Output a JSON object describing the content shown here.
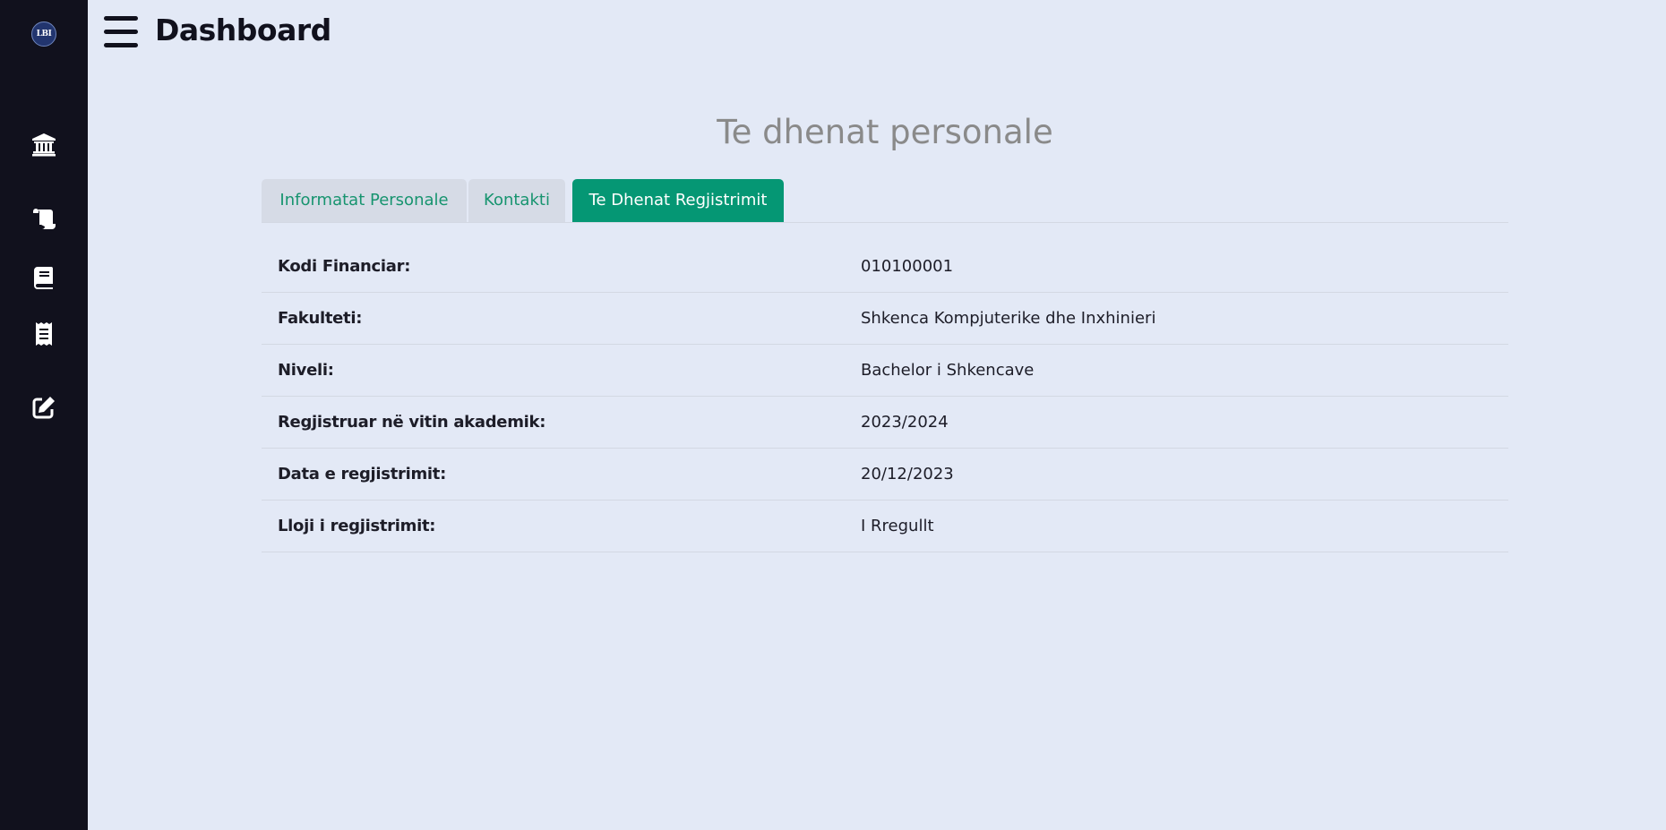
{
  "sidebar": {
    "logo_text": "LBI",
    "icons": [
      "university-icon",
      "scroll-icon",
      "book-icon",
      "receipt-icon",
      "edit-icon"
    ]
  },
  "header": {
    "title": "Dashboard",
    "menu_icon": "hamburger-menu-icon"
  },
  "main": {
    "section_title": "Te dhenat personale",
    "tabs": [
      {
        "label": "Informatat Personale",
        "active": false
      },
      {
        "label": "Kontakti",
        "active": false
      },
      {
        "label": "Te Dhenat Regjistrimit",
        "active": true
      }
    ],
    "rows": [
      {
        "label": "Kodi Financiar:",
        "value": "010100001"
      },
      {
        "label": "Fakulteti:",
        "value": "Shkenca Kompjuterike dhe Inxhinieri"
      },
      {
        "label": "Niveli:",
        "value": "Bachelor i Shkencave"
      },
      {
        "label": "Regjistruar në vitin akademik:",
        "value": "2023/2024"
      },
      {
        "label": "Data e regjistrimit:",
        "value": "20/12/2023"
      },
      {
        "label": "Lloji i regjistrimit:",
        "value": "I Rregullt"
      }
    ]
  },
  "colors": {
    "sidebar_bg": "#11111d",
    "page_bg": "#e3e9f6",
    "accent": "#059774",
    "tab_inactive_bg": "#d6dbe6",
    "tab_text": "#17946f"
  }
}
